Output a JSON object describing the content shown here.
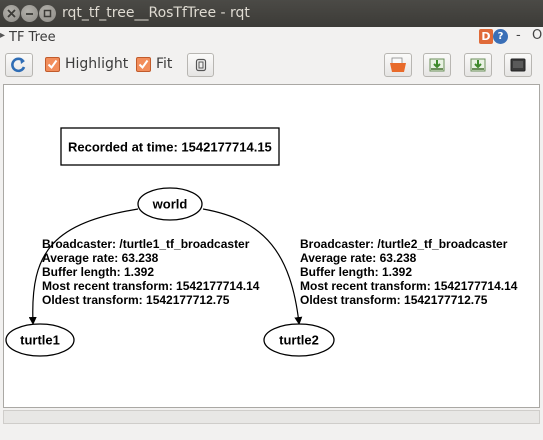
{
  "window": {
    "title": "rqt_tf_tree__RosTfTree - rqt",
    "controls": [
      "close-icon",
      "minimize-icon",
      "maximize-icon"
    ]
  },
  "plugin": {
    "title": "TF Tree",
    "help_letter": "D",
    "help_icon": "?",
    "dash_label": "-",
    "close_label": "O"
  },
  "toolbar": {
    "refresh_icon": "refresh-icon",
    "highlight": {
      "label": "Highlight",
      "checked": true
    },
    "fit": {
      "label": "Fit",
      "checked": true
    },
    "fit_in_view_icon": "fit-in-view-icon",
    "load_icon": "folder-open-icon",
    "save_dot_icon": "save-dot-icon",
    "save_svg_icon": "save-svg-icon",
    "save_image_icon": "save-image-icon"
  },
  "graph": {
    "recorded_label": "Recorded at time: 1542177714.15",
    "nodes": {
      "world": "world",
      "turtle1": "turtle1",
      "turtle2": "turtle2"
    },
    "edges": {
      "turtle1": [
        "Broadcaster: /turtle1_tf_broadcaster",
        "Average rate: 63.238",
        "Buffer length: 1.392",
        "Most recent transform: 1542177714.14",
        "Oldest transform: 1542177712.75"
      ],
      "turtle2": [
        "Broadcaster: /turtle2_tf_broadcaster",
        "Average rate: 63.238",
        "Buffer length: 1.392",
        "Most recent transform: 1542177714.14",
        "Oldest transform: 1542177712.75"
      ]
    }
  },
  "colors": {
    "titlebar": "#3c3b37",
    "checkbox": "#f28d5b",
    "help_d": "#e06a38",
    "help_q": "#3a6fb7"
  }
}
